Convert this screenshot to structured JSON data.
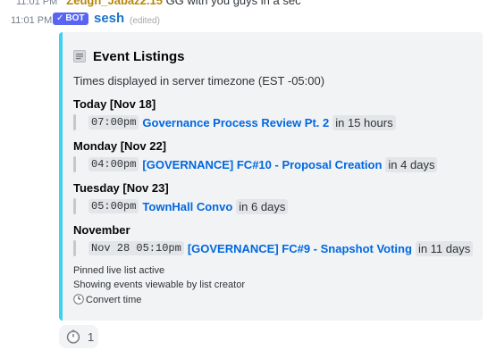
{
  "prev_message": {
    "time": "11:01 PM",
    "author": "Zeugh_Jabaz2.15",
    "text": "GG with you guys in a sec"
  },
  "message": {
    "time": "11:01 PM",
    "bot_badge": "BOT",
    "author": "sesh",
    "edited": "(edited)"
  },
  "embed": {
    "accent_color": "#3fd0f0",
    "title": "Event Listings",
    "title_icon": "document-icon",
    "description": "Times displayed in server timezone (EST -05:00)",
    "groups": [
      {
        "day": "Today [Nov 18]",
        "events": [
          {
            "time": "07:00pm",
            "title": "Governance Process Review Pt. 2",
            "relative": "in 15 hours"
          }
        ]
      },
      {
        "day": "Monday [Nov 22]",
        "events": [
          {
            "time": "04:00pm",
            "title": "[GOVERNANCE] FC#10 - Proposal Creation",
            "relative": "in 4 days"
          }
        ]
      },
      {
        "day": "Tuesday [Nov 23]",
        "events": [
          {
            "time": "05:00pm",
            "title": "TownHall Convo",
            "relative": "in 6 days"
          }
        ]
      },
      {
        "day": "November",
        "events": [
          {
            "time": "Nov 28 05:10pm",
            "title": "[GOVERNANCE] FC#9 - Snapshot Voting",
            "relative": "in 11 days"
          }
        ]
      }
    ],
    "footer": {
      "line1": "Pinned live list active",
      "line2": "Showing events viewable by list creator",
      "line3": "Convert time",
      "line3_icon": "clock-icon"
    }
  },
  "reaction": {
    "icon": "timer-icon",
    "count": "1"
  }
}
